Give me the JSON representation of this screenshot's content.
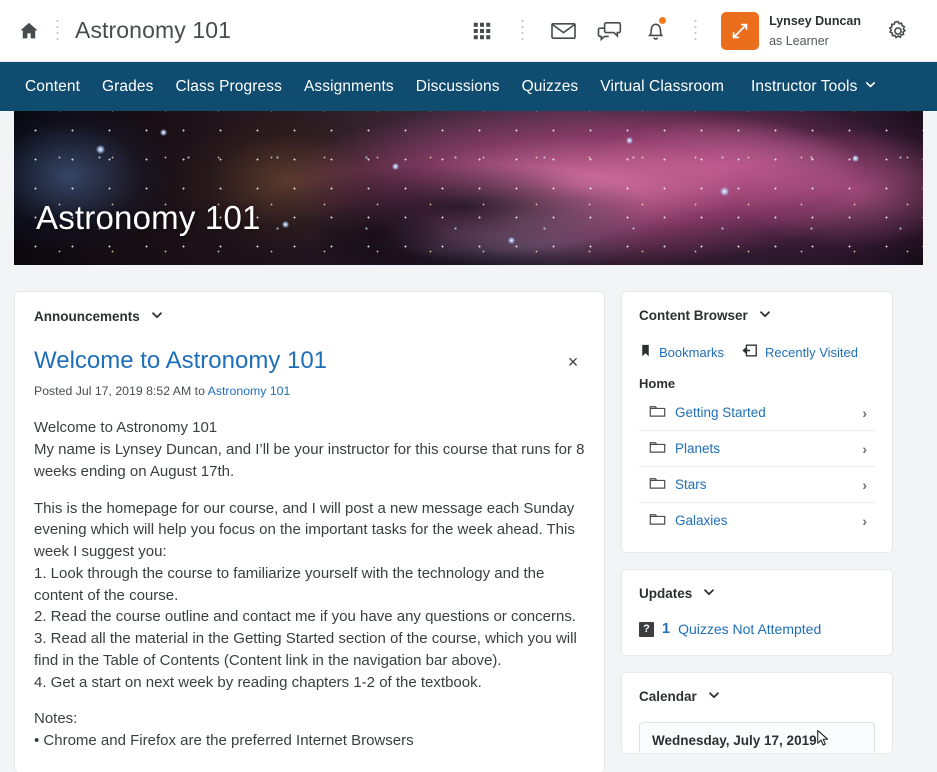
{
  "header": {
    "home_icon": "home-icon",
    "course_title": "Astronomy 101",
    "icons": {
      "waffle": "grid-menu-icon",
      "email": "envelope-icon",
      "messages": "chat-bubbles-icon",
      "alerts": "bell-icon",
      "settings": "gear-icon"
    },
    "user": {
      "name": "Lynsey Duncan",
      "role": "as Learner",
      "avatar_icon": "role-switch-icon"
    }
  },
  "navbar": {
    "items": [
      {
        "label": "Content",
        "caret": false
      },
      {
        "label": "Grades",
        "caret": false
      },
      {
        "label": "Class Progress",
        "caret": false
      },
      {
        "label": "Assignments",
        "caret": false
      },
      {
        "label": "Discussions",
        "caret": false
      },
      {
        "label": "Quizzes",
        "caret": false
      },
      {
        "label": "Virtual Classroom",
        "caret": false
      },
      {
        "label": "Instructor Tools",
        "caret": true
      }
    ],
    "color": "#0f4c70"
  },
  "banner": {
    "title": "Astronomy 101"
  },
  "announcements": {
    "panel_label": "Announcements",
    "title": "Welcome to Astronomy 101",
    "posted": "Posted Jul 17, 2019 8:52 AM to ",
    "posted_link": "Astronomy 101",
    "close_label": "×",
    "paragraphs": [
      "Welcome to Astronomy 101\nMy name is Lynsey Duncan, and I’ll be your instructor for this course that runs for 8 weeks ending on August 17th.",
      "This is the homepage for our course, and I will post a new message each Sunday evening which will help you focus on the important tasks for the week ahead. This week I suggest you:\n1. Look through the course to familiarize yourself with the technology and the content of the course.\n2. Read the course outline and contact me if you have any questions or concerns.\n3. Read all the material in the Getting Started section of the course, which you will find in the Table of Contents (Content link in the navigation bar above).\n4. Get a start on next week by reading chapters 1-2 of the textbook.",
      "Notes:\n• Chrome and Firefox are the preferred Internet Browsers"
    ]
  },
  "content_browser": {
    "panel_label": "Content Browser",
    "bookmarks_label": "Bookmarks",
    "bookmarks_icon": "bookmark-icon",
    "recent_label": "Recently Visited",
    "recent_icon": "recently-visited-icon",
    "home_label": "Home",
    "folders": [
      {
        "label": "Getting Started",
        "icon": "folder-icon"
      },
      {
        "label": "Planets",
        "icon": "folder-icon"
      },
      {
        "label": "Stars",
        "icon": "folder-icon"
      },
      {
        "label": "Galaxies",
        "icon": "folder-icon"
      }
    ]
  },
  "updates": {
    "panel_label": "Updates",
    "quiz_icon": "quiz-icon",
    "count": "1",
    "text": "Quizzes Not Attempted"
  },
  "calendar": {
    "panel_label": "Calendar",
    "date": "Wednesday, July 17, 2019"
  },
  "colors": {
    "nav_blue": "#0f4c70",
    "link_blue": "#1f6fb8",
    "accent_orange": "#ea6e1c",
    "page_bg": "#f3f4f6"
  }
}
